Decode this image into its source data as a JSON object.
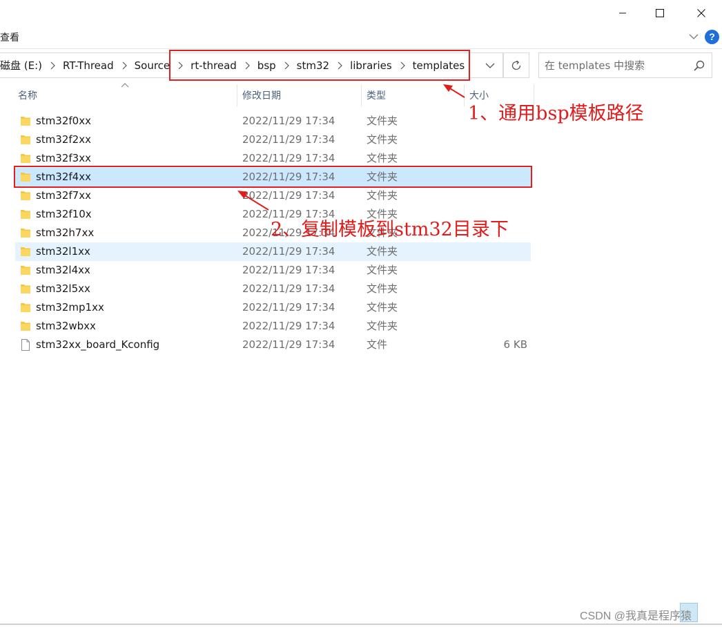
{
  "ribbon": {
    "view_label": "查看"
  },
  "address": {
    "crumbs": [
      "磁盘 (E:)",
      "RT-Thread",
      "Source",
      "rt-thread",
      "bsp",
      "stm32",
      "libraries",
      "templates"
    ]
  },
  "search": {
    "placeholder": "在 templates 中搜索"
  },
  "columns": {
    "name": "名称",
    "date": "修改日期",
    "type": "类型",
    "size": "大小"
  },
  "files": [
    {
      "name": "stm32f0xx",
      "date": "2022/11/29 17:34",
      "type": "文件夹",
      "size": "",
      "icon": "folder-icon"
    },
    {
      "name": "stm32f2xx",
      "date": "2022/11/29 17:34",
      "type": "文件夹",
      "size": "",
      "icon": "folder-icon"
    },
    {
      "name": "stm32f3xx",
      "date": "2022/11/29 17:34",
      "type": "文件夹",
      "size": "",
      "icon": "folder-icon"
    },
    {
      "name": "stm32f4xx",
      "date": "2022/11/29 17:34",
      "type": "文件夹",
      "size": "",
      "icon": "folder-icon",
      "state": "selected"
    },
    {
      "name": "stm32f7xx",
      "date": "2022/11/29 17:34",
      "type": "文件夹",
      "size": "",
      "icon": "folder-icon"
    },
    {
      "name": "stm32f10x",
      "date": "2022/11/29 17:34",
      "type": "文件夹",
      "size": "",
      "icon": "folder-icon"
    },
    {
      "name": "stm32h7xx",
      "date": "2022/11/29 17:34",
      "type": "文件夹",
      "size": "",
      "icon": "folder-icon"
    },
    {
      "name": "stm32l1xx",
      "date": "2022/11/29 17:34",
      "type": "文件夹",
      "size": "",
      "icon": "folder-icon",
      "state": "hover"
    },
    {
      "name": "stm32l4xx",
      "date": "2022/11/29 17:34",
      "type": "文件夹",
      "size": "",
      "icon": "folder-icon"
    },
    {
      "name": "stm32l5xx",
      "date": "2022/11/29 17:34",
      "type": "文件夹",
      "size": "",
      "icon": "folder-icon"
    },
    {
      "name": "stm32mp1xx",
      "date": "2022/11/29 17:34",
      "type": "文件夹",
      "size": "",
      "icon": "folder-icon"
    },
    {
      "name": "stm32wbxx",
      "date": "2022/11/29 17:34",
      "type": "文件夹",
      "size": "",
      "icon": "folder-icon"
    },
    {
      "name": "stm32xx_board_Kconfig",
      "date": "2022/11/29 17:34",
      "type": "文件",
      "size": "6 KB",
      "icon": "file-icon"
    }
  ],
  "annotations": {
    "note1": "1、通用bsp模板路径",
    "note2": "2、复制模板到stm32目录下",
    "color": "#e21b1b"
  },
  "watermark": "CSDN @我真是程序猿",
  "colors": {
    "selected": "#cce8ff",
    "hover": "#e5f3ff",
    "folder": "#f4c842",
    "header_text": "#4c607a"
  }
}
